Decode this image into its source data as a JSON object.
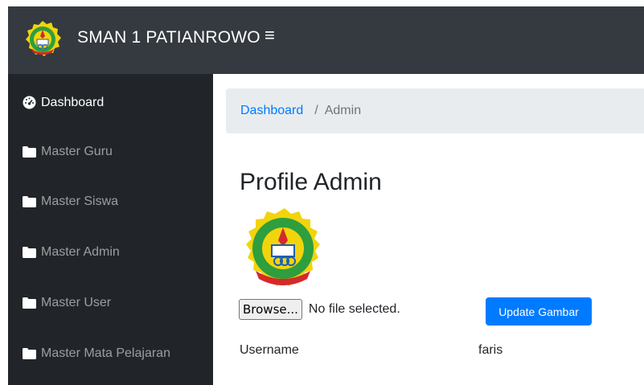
{
  "header": {
    "brand_name": "SMAN 1 PATIANROWO",
    "menu_toggle_icon": "hamburger-icon",
    "background_color": "#343a40"
  },
  "sidebar": {
    "background_color": "#212529",
    "items": [
      {
        "label": "Dashboard",
        "icon": "tachometer-icon",
        "active": true
      },
      {
        "label": "Master Guru",
        "icon": "folder-icon",
        "active": false
      },
      {
        "label": "Master Siswa",
        "icon": "folder-icon",
        "active": false
      },
      {
        "label": "Master Admin",
        "icon": "folder-icon",
        "active": false
      },
      {
        "label": "Master User",
        "icon": "folder-icon",
        "active": false
      },
      {
        "label": "Master Mata Pelajaran",
        "icon": "folder-icon",
        "active": false
      }
    ]
  },
  "breadcrumb": {
    "link": "Dashboard",
    "separator": "/",
    "current": "Admin"
  },
  "main": {
    "title": "Profile Admin",
    "file_input": {
      "button_label": "Browse...",
      "status": "No file selected."
    },
    "update_button_label": "Update Gambar",
    "fields": [
      {
        "label": "Username",
        "value": "faris"
      }
    ]
  },
  "colors": {
    "primary": "#007bff",
    "breadcrumb_bg": "#e9ecef",
    "logo_green": "#2e9e3e",
    "logo_yellow": "#f2d40c",
    "logo_red": "#d42a2a"
  }
}
